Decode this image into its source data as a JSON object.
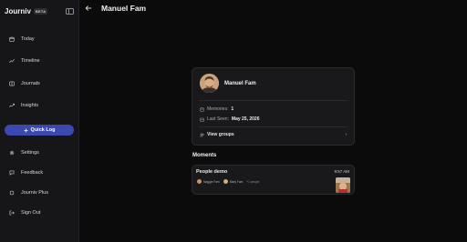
{
  "app": {
    "name": "Journiv",
    "badge": "BETA"
  },
  "nav": {
    "today": "Today",
    "timeline": "Timeline",
    "journals": "Journals",
    "insights": "Insights",
    "quick_log": "Quick Log",
    "settings": "Settings",
    "feedback": "Feedback",
    "plus": "Journiv Plus",
    "sign_out": "Sign Out"
  },
  "header": {
    "title": "Manuel Fam"
  },
  "profile": {
    "name": "Manuel Fam",
    "memories_label": "Memories:",
    "memories_value": "1",
    "last_seen_label": "Last Seen:",
    "last_seen_value": "May 25, 2026",
    "groups_label": "View groups"
  },
  "moments": {
    "section_title": "Moments",
    "items": [
      {
        "title": "People demo",
        "time": "9:57 AM",
        "people": [
          "Maggie Fam",
          "Baby Fam"
        ],
        "more": "+1 people"
      }
    ]
  },
  "colors": {
    "accent": "#3b48b0",
    "background": "#0b0b0c",
    "sidebar": "#161618",
    "card": "#19191b"
  }
}
